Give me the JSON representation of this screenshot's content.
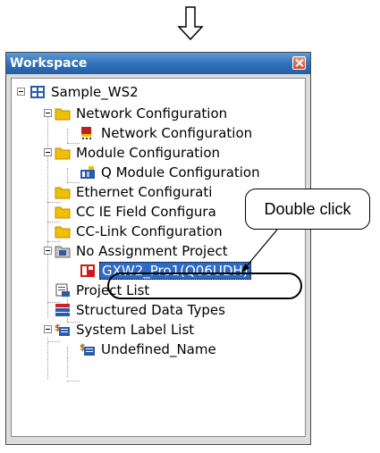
{
  "window": {
    "title": "Workspace"
  },
  "tree": {
    "root": "Sample_WS2",
    "items": [
      {
        "label": "Network Configuration"
      },
      {
        "label": "Network Configuration"
      },
      {
        "label": "Module Configuration"
      },
      {
        "label": "Q Module Configuration"
      },
      {
        "label": "Ethernet Configurati"
      },
      {
        "label": "CC IE Field Configura"
      },
      {
        "label": "CC-Link Configuration"
      },
      {
        "label": "No Assignment Project"
      },
      {
        "label": "GXW2_Pro1(Q06UDH)"
      },
      {
        "label": "Project List"
      },
      {
        "label": "Structured Data Types"
      },
      {
        "label": "System Label List"
      },
      {
        "label": "Undefined_Name"
      }
    ]
  },
  "annotation": {
    "callout_text": "Double click"
  },
  "colors": {
    "titlebar": "#2f6fb8",
    "selection": "#316ac5",
    "folder": "#f0c000"
  }
}
